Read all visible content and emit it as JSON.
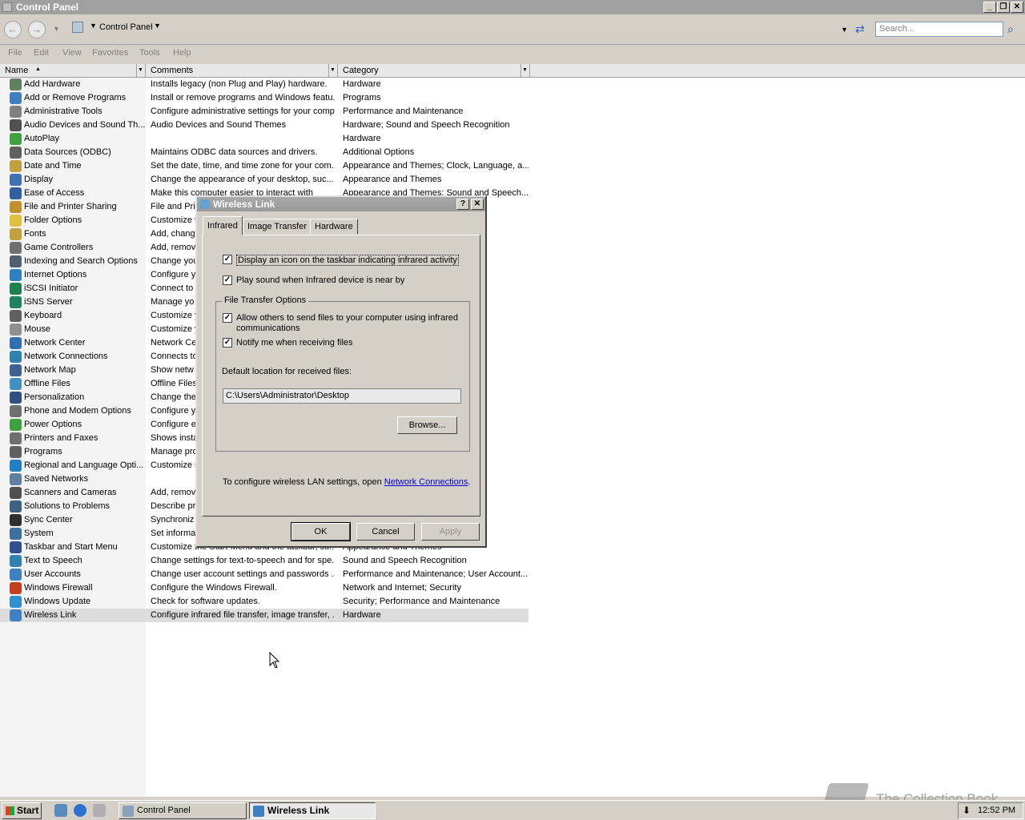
{
  "window": {
    "title": "Control Panel"
  },
  "address": {
    "location": "Control Panel",
    "search_placeholder": "Search..."
  },
  "menu": [
    "File",
    "Edit",
    "View",
    "Favorites",
    "Tools",
    "Help"
  ],
  "columns": {
    "name": "Name",
    "comments": "Comments",
    "category": "Category"
  },
  "items": [
    {
      "name": "Add Hardware",
      "comment": "Installs legacy (non Plug and Play) hardware.",
      "category": "Hardware",
      "color": "#608060"
    },
    {
      "name": "Add or Remove Programs",
      "comment": "Install or remove programs and Windows featu...",
      "category": "Programs",
      "color": "#4080c0"
    },
    {
      "name": "Administrative Tools",
      "comment": "Configure administrative settings for your comp...",
      "category": "Performance and Maintenance",
      "color": "#808080"
    },
    {
      "name": "Audio Devices and Sound Th...",
      "comment": "Audio Devices and Sound Themes",
      "category": "Hardware; Sound and Speech Recognition",
      "color": "#505050"
    },
    {
      "name": "AutoPlay",
      "comment": "",
      "category": "Hardware",
      "color": "#40a040"
    },
    {
      "name": "Data Sources (ODBC)",
      "comment": "Maintains ODBC data sources and drivers.",
      "category": "Additional Options",
      "color": "#606060"
    },
    {
      "name": "Date and Time",
      "comment": "Set the date, time, and time zone for your com...",
      "category": "Appearance and Themes; Clock, Language, a...",
      "color": "#c0a040"
    },
    {
      "name": "Display",
      "comment": "Change the appearance of your desktop, suc...",
      "category": "Appearance and Themes",
      "color": "#4070b0"
    },
    {
      "name": "Ease of Access",
      "comment": "Make this computer easier to interact with",
      "category": "Appearance and Themes; Sound and Speech...",
      "color": "#3060a0"
    },
    {
      "name": "File and Printer Sharing",
      "comment": "File and Pri",
      "category": "",
      "color": "#c09030"
    },
    {
      "name": "Folder Options",
      "comment": "Customize t",
      "category": "",
      "color": "#e0c040"
    },
    {
      "name": "Fonts",
      "comment": "Add, chang",
      "category": "",
      "color": "#c0a040"
    },
    {
      "name": "Game Controllers",
      "comment": "Add, remov",
      "category": "",
      "color": "#707070"
    },
    {
      "name": "Indexing and Search Options",
      "comment": "Change you",
      "category": "",
      "color": "#506070"
    },
    {
      "name": "Internet Options",
      "comment": "Configure y",
      "category": "",
      "color": "#3080c0"
    },
    {
      "name": "iSCSI Initiator",
      "comment": "Connect to",
      "category": "",
      "color": "#208050"
    },
    {
      "name": "iSNS Server",
      "comment": "Manage yo",
      "category": "",
      "color": "#208060"
    },
    {
      "name": "Keyboard",
      "comment": "Customize y",
      "category": "",
      "color": "#606060"
    },
    {
      "name": "Mouse",
      "comment": "Customize y",
      "category": "",
      "color": "#909090"
    },
    {
      "name": "Network Center",
      "comment": "Network Ce",
      "category": "",
      "color": "#3070b0"
    },
    {
      "name": "Network Connections",
      "comment": "Connects to",
      "category": "",
      "color": "#3080b0"
    },
    {
      "name": "Network Map",
      "comment": "Show netw",
      "category": "",
      "color": "#406090"
    },
    {
      "name": "Offline Files",
      "comment": "Offline Files",
      "category": "s and Sy...",
      "color": "#4090c0"
    },
    {
      "name": "Personalization",
      "comment": "Change the",
      "category": "",
      "color": "#305080"
    },
    {
      "name": "Phone and Modem Options",
      "comment": "Configure y",
      "category": "",
      "color": "#707070"
    },
    {
      "name": "Power Options",
      "comment": "Configure e",
      "category": "nce",
      "color": "#40a040"
    },
    {
      "name": "Printers and Faxes",
      "comment": "Shows insta",
      "category": "",
      "color": "#707070"
    },
    {
      "name": "Programs",
      "comment": "Manage pro",
      "category": "",
      "color": "#606060"
    },
    {
      "name": "Regional and Language Opti...",
      "comment": "Customize s",
      "category": "",
      "color": "#2080c0"
    },
    {
      "name": "Saved Networks",
      "comment": "",
      "category": "",
      "color": "#6080a0"
    },
    {
      "name": "Scanners and Cameras",
      "comment": "Add, remov",
      "category": "",
      "color": "#505050"
    },
    {
      "name": "Solutions to Problems",
      "comment": "Describe pr",
      "category": "",
      "color": "#406080"
    },
    {
      "name": "Sync Center",
      "comment": "Synchroniz",
      "category": "",
      "color": "#303030"
    },
    {
      "name": "System",
      "comment": "Set informa",
      "category": "nce",
      "color": "#4070a0"
    },
    {
      "name": "Taskbar and Start Menu",
      "comment": "Customize the Start Menu and the taskbar, su...",
      "category": "Appearance and Themes",
      "color": "#305090"
    },
    {
      "name": "Text to Speech",
      "comment": "Change settings for text-to-speech and for spe...",
      "category": "Sound and Speech Recognition",
      "color": "#3080b0"
    },
    {
      "name": "User Accounts",
      "comment": "Change user account settings and passwords ...",
      "category": "Performance and Maintenance; User Account...",
      "color": "#4080c0"
    },
    {
      "name": "Windows Firewall",
      "comment": "Configure the Windows Firewall.",
      "category": "Network and Internet; Security",
      "color": "#c04020"
    },
    {
      "name": "Windows Update",
      "comment": "Check for software updates.",
      "category": "Security; Performance and Maintenance",
      "color": "#3090d0"
    },
    {
      "name": "Wireless Link",
      "comment": "Configure infrared file transfer, image transfer, ...",
      "category": "Hardware",
      "color": "#4080c0"
    }
  ],
  "dialog": {
    "title": "Wireless Link",
    "tabs": [
      "Infrared",
      "Image Transfer",
      "Hardware"
    ],
    "opt_taskbar_icon": "Display an icon on the taskbar indicating infrared activity",
    "opt_play_sound": "Play sound when Infrared device is near by",
    "group_title": "File Transfer Options",
    "opt_allow_send_1": "Allow others to send files to your computer using infrared",
    "opt_allow_send_2": "communications",
    "opt_notify": "Notify me when receiving files",
    "default_location_label": "Default location for received files:",
    "default_location_value": "C:\\Users\\Administrator\\Desktop",
    "browse_label": "Browse...",
    "footer_text": "To configure wireless LAN settings, open",
    "footer_link": "Network Connections",
    "footer_period": ".",
    "ok_label": "OK",
    "cancel_label": "Cancel",
    "apply_label": "Apply",
    "checkmark": "✓"
  },
  "taskbar": {
    "start_label": "Start",
    "tasks": [
      "Control Panel",
      "Wireless Link"
    ],
    "clock": "12:52 PM"
  },
  "watermark": "The Collection Book"
}
